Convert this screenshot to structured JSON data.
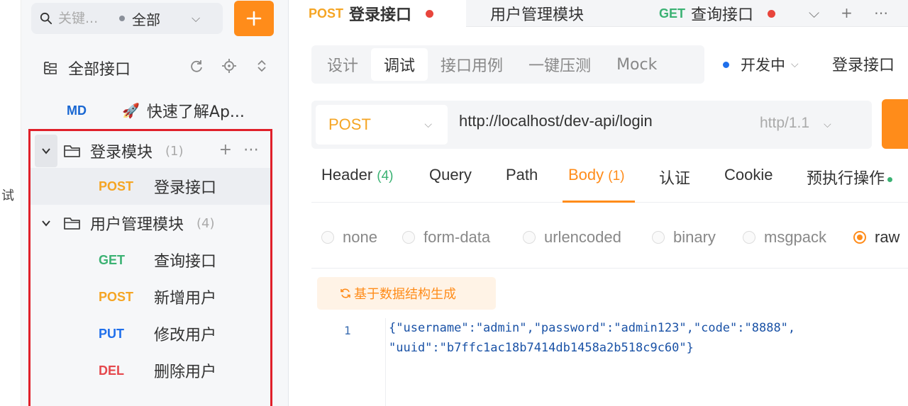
{
  "strip": {
    "label": "试"
  },
  "sidebar": {
    "search_placeholder": "关键...",
    "scope_label": "全部",
    "all_apis_title": "全部接口",
    "md_item": {
      "badge": "MD",
      "label": "快速了解Ap..."
    },
    "folders": [
      {
        "name": "登录模块",
        "count": "(1)",
        "endpoints": [
          {
            "method": "POST",
            "name": "登录接口"
          }
        ]
      },
      {
        "name": "用户管理模块",
        "count": "(4)",
        "endpoints": [
          {
            "method": "GET",
            "name": "查询接口"
          },
          {
            "method": "POST",
            "name": "新增用户"
          },
          {
            "method": "PUT",
            "name": "修改用户"
          },
          {
            "method": "DEL",
            "name": "删除用户"
          }
        ]
      }
    ]
  },
  "tabs": [
    {
      "method": "POST",
      "title": "登录接口"
    },
    {
      "method": "",
      "title": "用户管理模块"
    },
    {
      "method": "GET",
      "title": "查询接口"
    }
  ],
  "mode_tabs": [
    "设计",
    "调试",
    "接口用例",
    "一键压测",
    "Mock"
  ],
  "status": {
    "label": "开发中"
  },
  "doc_name": "登录接口",
  "request": {
    "method": "POST",
    "url": "http://localhost/dev-api/login",
    "http_version": "http/1.1"
  },
  "request_tabs": [
    {
      "label": "Header",
      "count": "(4)"
    },
    {
      "label": "Query",
      "count": ""
    },
    {
      "label": "Path",
      "count": ""
    },
    {
      "label": "Body",
      "count": "(1)"
    },
    {
      "label": "认证",
      "count": ""
    },
    {
      "label": "Cookie",
      "count": ""
    },
    {
      "label": "预执行操作",
      "count": ""
    }
  ],
  "body_types": [
    "none",
    "form-data",
    "urlencoded",
    "binary",
    "msgpack",
    "raw"
  ],
  "editor": {
    "generate_label": "基于数据结构生成",
    "line_number": "1",
    "code_lines": [
      "{\"username\":\"admin\",\"password\":\"admin123\",\"code\":\"8888\",",
      "\"uuid\":\"b7ffc1ac18b7414db1458a2b518c9c60\"}"
    ]
  },
  "colors": {
    "accent": "#ff8c1a",
    "post": "#f5a524",
    "get": "#3bb273",
    "put": "#1f6feb",
    "del": "#e5484d",
    "highlight_border": "#e0202a"
  },
  "icons": [
    "search-icon",
    "plus-icon",
    "tree-icon",
    "refresh-icon",
    "locate-icon",
    "expand-collapse-icon",
    "rocket-icon",
    "folder-icon",
    "caret-down-icon",
    "more-icon",
    "chevron-down-icon",
    "sync-icon"
  ]
}
